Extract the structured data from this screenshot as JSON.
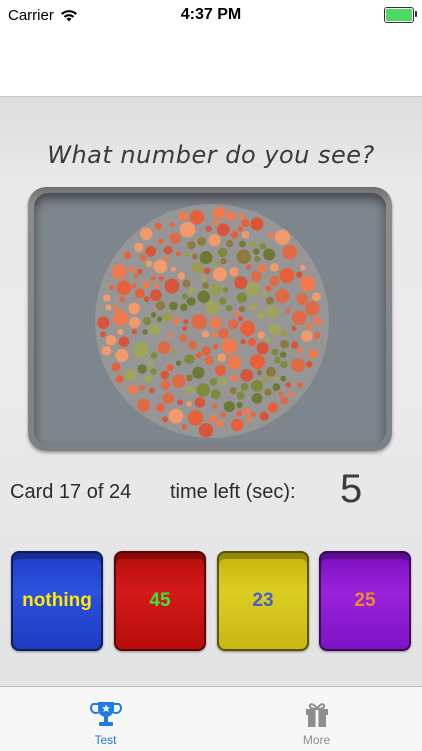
{
  "status_bar": {
    "carrier": "Carrier",
    "time": "4:37 PM",
    "battery_color": "#4cd964"
  },
  "test": {
    "title": "What number do you see?",
    "card_info": "Card 17 of 24",
    "time_left_label": "time left (sec):",
    "time_left_value": "5"
  },
  "answers": [
    {
      "label": "nothing",
      "bg": "#2c51e0",
      "text_color": "#ffea00"
    },
    {
      "label": "45",
      "bg": "#d41a1a",
      "text_color": "#3ce43c"
    },
    {
      "label": "23",
      "bg": "#dccd23",
      "text_color": "#4460c8"
    },
    {
      "label": "25",
      "bg": "#9a23dc",
      "text_color": "#f08a2d"
    }
  ],
  "tab_bar": {
    "tabs": [
      {
        "label": "Test",
        "icon": "trophy-icon",
        "active": true
      },
      {
        "label": "More",
        "icon": "gift-icon",
        "active": false
      }
    ],
    "active_color": "#1f7ce6",
    "inactive_color": "#8e8e8e"
  },
  "plate_colors": {
    "background": [
      "#e8603a",
      "#f07a4e",
      "#d9553a",
      "#f29a6a",
      "#e06a45"
    ],
    "figure": [
      "#7f8a3b",
      "#9a9c4a",
      "#6c7a34",
      "#8e7a3c",
      "#a1a55a"
    ]
  }
}
